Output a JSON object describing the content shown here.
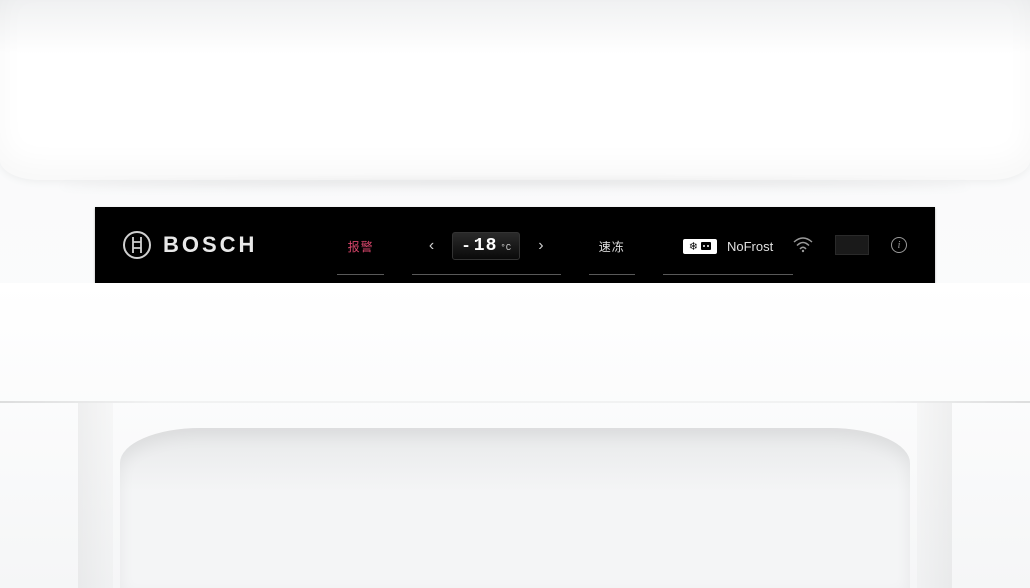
{
  "brand": "BOSCH",
  "panel": {
    "alarm_label": "报警",
    "temp": {
      "sign": "-",
      "value": "18",
      "unit": "°C"
    },
    "superfreeze_label": "速冻",
    "nofrost": {
      "snowflake": "❄",
      "label": "NoFrost"
    }
  },
  "icons": {
    "decrease": "‹",
    "increase": "›",
    "info": "i"
  }
}
